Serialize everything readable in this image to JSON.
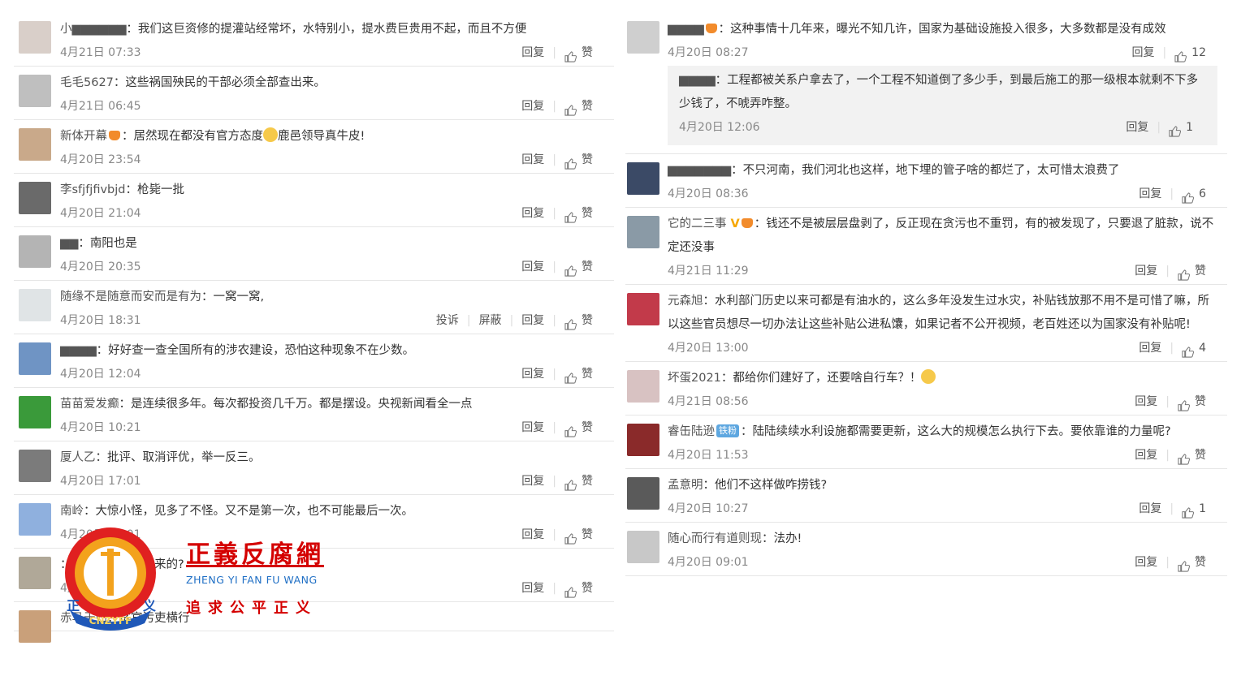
{
  "actions": {
    "reply": "回复",
    "like": "赞",
    "report": "投诉",
    "block": "屏蔽"
  },
  "left": [
    {
      "user": "小▆▆▆▆▆▆",
      "text": "我们这巨资修的提灌站经常坏，水特别小，提水费巨贵用不起，而且不方便",
      "time": "4月21日 07:33",
      "likes": "赞",
      "avatar": "#d9cfc9",
      "blurred": true
    },
    {
      "user": "毛毛5627",
      "text": "这些祸国殃民的干部必须全部查出来。",
      "time": "4月21日 06:45",
      "likes": "赞",
      "avatar": "#bfbfbf"
    },
    {
      "user": "新体开幕",
      "text": "居然现在都没有官方态度",
      "text2": "鹿邑领导真牛皮!",
      "time": "4月20日 23:54",
      "likes": "赞",
      "avatar": "#c9a98a",
      "crown": true,
      "emoji": true
    },
    {
      "user": "李sfjfjfivbjd",
      "text": "枪毙一批",
      "time": "4月20日 21:04",
      "likes": "赞",
      "avatar": "#6a6a6a"
    },
    {
      "user": "▆▆",
      "text": "南阳也是",
      "time": "4月20日 20:35",
      "likes": "赞",
      "avatar": "#b4b4b4",
      "blurred": true
    },
    {
      "user": "随缘不是随意而安而是有为",
      "text": "一窝一窝,",
      "time": "4月20日 18:31",
      "likes": "赞",
      "avatar": "#e0e4e6",
      "extra": true
    },
    {
      "user": "▆▆▆▆",
      "text": "好好查一查全国所有的涉农建设，恐怕这种现象不在少数。",
      "time": "4月20日 12:04",
      "likes": "赞",
      "avatar": "#6f94c4",
      "blurred": true
    },
    {
      "user": "苗苗爱发癫",
      "text": "是连续很多年。每次都投资几千万。都是摆设。央视新闻看全一点",
      "time": "4月20日 10:21",
      "likes": "赞",
      "avatar": "#3a9a3a"
    },
    {
      "user": "厦人乙",
      "text": "批评、取消评优，举一反三。",
      "time": "4月20日 17:01",
      "likes": "赞",
      "avatar": "#7b7b7b"
    },
    {
      "user": "南岭",
      "text": "大惊小怪，见多了不怪。又不是第一次，也不可能最后一次。",
      "time": "4月20日 17:01",
      "likes": "赞",
      "avatar": "#8fb0de"
    },
    {
      "user": "",
      "text": "包工头的豪车哪来的?",
      "time": "4月20日",
      "likes": "赞",
      "avatar": "#b0a898"
    },
    {
      "user": "赤马于归",
      "text": "贪官污吏横行",
      "time": "",
      "likes": "",
      "avatar": "#c9a07a"
    }
  ],
  "right": [
    {
      "user": "▆▆▆▆",
      "text": "这种事情十几年来，曝光不知几许，国家为基础设施投入很多，大多数都是没有成效",
      "time": "4月20日 08:27",
      "likes": "12",
      "avatar": "#cfcfcf",
      "blurred": true,
      "crown": true,
      "reply": {
        "user": "▆▆▆▆",
        "text": "工程都被关系户拿去了，一个工程不知道倒了多少手，到最后施工的那一级根本就剩不下多少钱了，不唬弄咋整。",
        "time": "4月20日 12:06",
        "likes": "1"
      }
    },
    {
      "user": "▆▆▆▆▆▆▆",
      "text": "不只河南，我们河北也这样，地下埋的管子啥的都烂了，太可惜太浪费了",
      "time": "4月20日 08:36",
      "likes": "6",
      "avatar": "#3b4a66",
      "blurred": true
    },
    {
      "user": "它的二三事",
      "text": "钱还不是被层层盘剥了，反正现在贪污也不重罚，有的被发现了，只要退了脏款，说不定还没事",
      "time": "4月21日 11:29",
      "likes": "赞",
      "avatar": "#8a9aa6",
      "vip": true,
      "crown": true
    },
    {
      "user": "元森旭",
      "text": "水利部门历史以来可都是有油水的，这么多年没发生过水灾，补贴钱放那不用不是可惜了嘛，所以这些官员想尽一切办法让这些补贴公进私馕，如果记者不公开视频，老百姓还以为国家没有补贴呢!",
      "time": "4月20日 13:00",
      "likes": "4",
      "avatar": "#c23a4a"
    },
    {
      "user": "坏蛋2021",
      "text": "都给你们建好了，还要啥自行车？！",
      "time": "4月21日 08:56",
      "likes": "赞",
      "avatar": "#d8c2c2",
      "emoji": true
    },
    {
      "user": "睿缶陆逊",
      "badge": "铁粉",
      "text": "陆陆续续水利设施都需要更新，这么大的规模怎么执行下去。要依靠谁的力量呢?",
      "time": "4月20日 11:53",
      "likes": "赞",
      "avatar": "#8a2a2a"
    },
    {
      "user": "孟意明",
      "text": "他们不这样做咋捞钱?",
      "time": "4月20日 10:27",
      "likes": "1",
      "avatar": "#5a5a5a"
    },
    {
      "user": "随心而行有道则现",
      "text": "法办!",
      "time": "4月20日 09:01",
      "likes": "赞",
      "avatar": "#c8c8c8"
    }
  ],
  "watermark": {
    "title": "正義反腐網",
    "pinyin": "ZHENG YI FAN FU WANG",
    "slogan": "追求公平正义",
    "logo_text": "CNZYFF",
    "logo_side_left": "正",
    "logo_side_right": "义"
  }
}
